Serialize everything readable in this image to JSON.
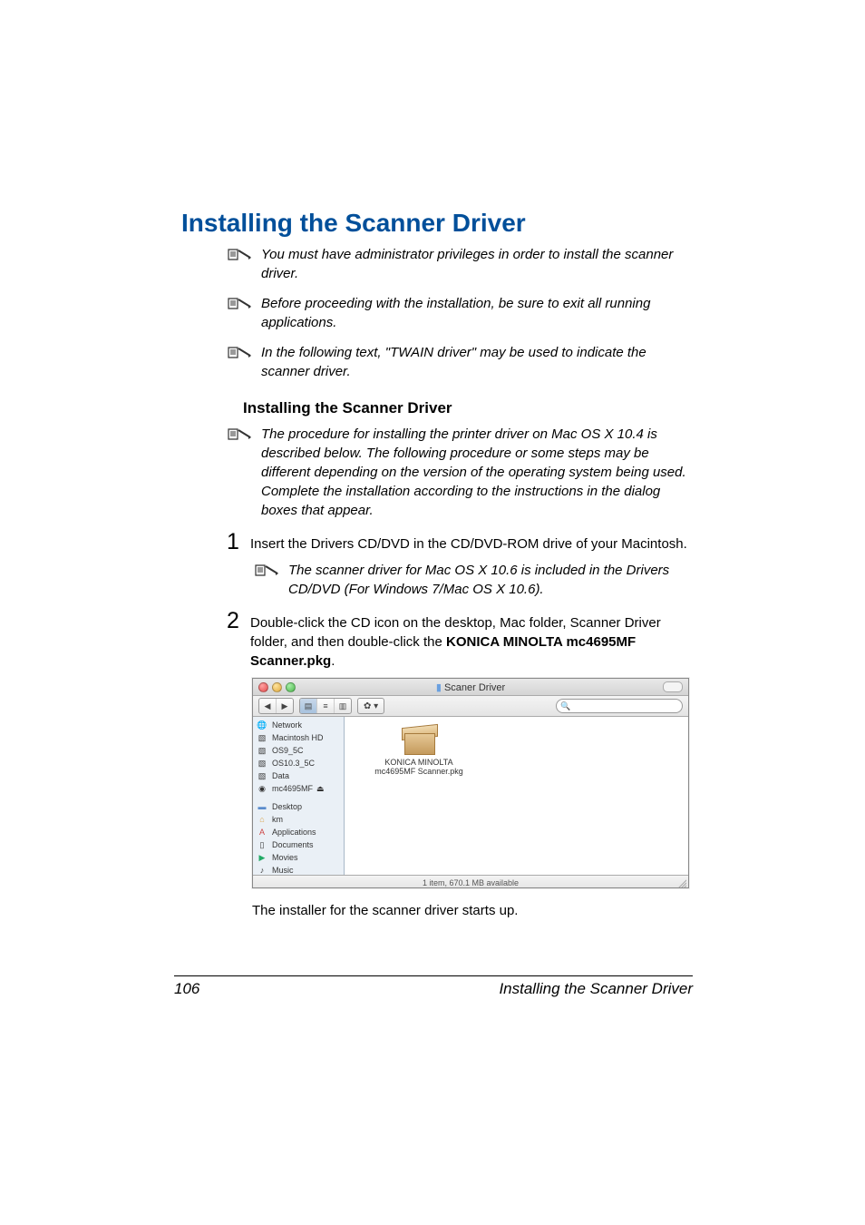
{
  "header": {
    "title": "Installing the Scanner Driver"
  },
  "notes": {
    "n1": "You must have administrator privileges in order to install the scanner driver.",
    "n2": "Before proceeding with the installation, be sure to exit all running applications.",
    "n3": "In the following text, \"TWAIN driver\" may be used to indicate the scanner driver."
  },
  "subheading": "Installing the Scanner Driver",
  "procedure_note": "The procedure for installing the printer driver on Mac OS X 10.4 is described below. The following procedure or some steps may be different depending on the version of the operating system being used. Complete the installation according to the instructions in the dialog boxes that appear.",
  "steps": {
    "s1": {
      "num": "1",
      "text": "Insert the Drivers CD/DVD in the CD/DVD-ROM drive of your Macintosh."
    },
    "s1_note": "The scanner driver for Mac OS X 10.6 is included in the Drivers CD/DVD (For Windows 7/Mac OS X 10.6).",
    "s2": {
      "num": "2",
      "pre": "Double-click the CD icon on the desktop, Mac folder, Scanner Driver folder, and then double-click the ",
      "bold": "KONICA MINOLTA mc4695MF Scanner.pkg",
      "post": "."
    }
  },
  "finder": {
    "title": "Scaner Driver",
    "gear_label": "✿ ▾",
    "sidebar": {
      "i0": "Network",
      "i1": "Macintosh HD",
      "i2": "OS9_5C",
      "i3": "OS10.3_5C",
      "i4": "Data",
      "i5": "mc4695MF",
      "i6": "Desktop",
      "i7": "km",
      "i8": "Applications",
      "i9": "Documents",
      "i10": "Movies",
      "i11": "Music"
    },
    "file_line1": "KONICA MINOLTA",
    "file_line2": "mc4695MF Scanner.pkg",
    "status": "1 item, 670.1 MB available"
  },
  "installer_after": "The installer for the scanner driver starts up.",
  "footer": {
    "page": "106",
    "title": "Installing the Scanner Driver"
  }
}
